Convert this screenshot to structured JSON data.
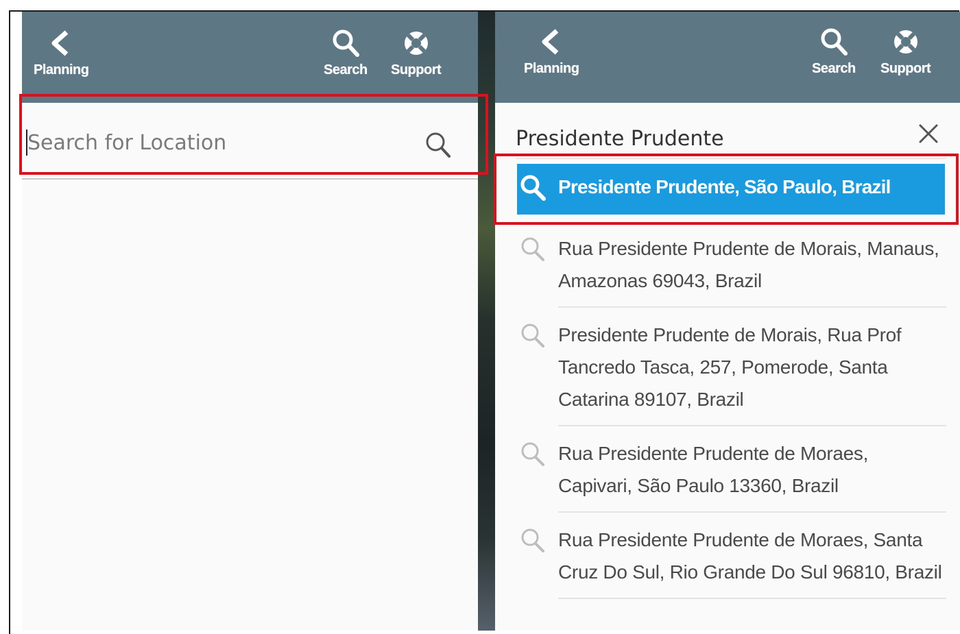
{
  "header": {
    "back_label": "Planning",
    "search_label": "Search",
    "support_label": "Support"
  },
  "left_panel": {
    "search_placeholder": "Search for Location"
  },
  "right_panel": {
    "query": "Presidente Prudente",
    "results": [
      "Presidente Prudente, São Paulo, Brazil",
      "Rua Presidente Prudente de Morais, Manaus, Amazonas 69043, Brazil",
      "Presidente Prudente de Morais, Rua Prof Tancredo Tasca, 257, Pomerode, Santa Catarina 89107, Brazil",
      "Rua Presidente Prudente de Moraes, Capivari, São Paulo 13360, Brazil",
      "Rua Presidente Prudente de Moraes, Santa Cruz Do Sul, Rio Grande Do Sul 96810, Brazil"
    ],
    "active_index": 0
  },
  "icons": {
    "back": "chevron-left-icon",
    "search": "magnifier-icon",
    "support": "lifebuoy-icon",
    "clear": "close-icon"
  },
  "colors": {
    "header_bg": "#5e7785",
    "active_result": "#1a9be0",
    "highlight": "#d6131e"
  }
}
